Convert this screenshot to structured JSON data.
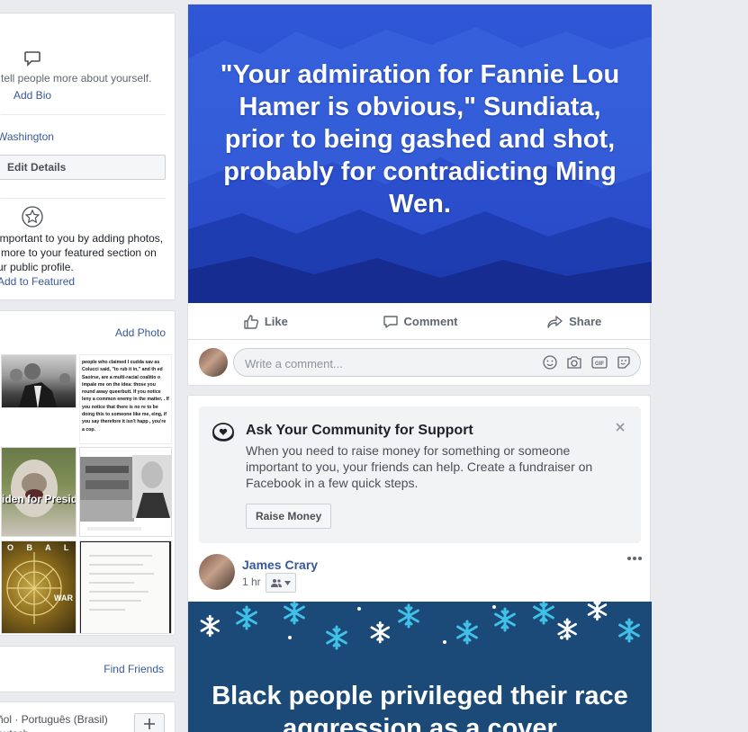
{
  "intro": {
    "bio_prompt": "tell people more about yourself.",
    "add_bio": "Add Bio",
    "location": "Washington",
    "edit_details": "Edit Details",
    "featured_line1": "important to you by adding photos,",
    "featured_line2": "more to your featured section on",
    "featured_line3": "ur public profile.",
    "add_featured": "Add to Featured"
  },
  "photos": {
    "add_photo": "Add Photo",
    "meme_text": "people who claimed I cudda sav as Colucci said, \"to rub it in,\" and th ed Saoirse, are a multi-racial coalitio o impale me on the idea: those you round away queerbutt. If you notice leny a common enemy in the matter, . If you notice that there is no re to be doing this to someone like me, eing, if you say therefore it isn't happ , you're a cop.",
    "caption_biden": "iden for Preside",
    "caption_war": "O B A L",
    "caption_war2": "WAR"
  },
  "friends": {
    "find_friends": "Find Friends"
  },
  "languages": {
    "text": "ñol · Português (Brasil)",
    "text2": "eutsch"
  },
  "post1": {
    "quote": "\"Your admiration for Fannie Lou Hamer is obvious,\" Sundiata, prior to being gashed and shot, probably for contradicting Ming Wen.",
    "like": "Like",
    "comment": "Comment",
    "share": "Share",
    "comment_placeholder": "Write a comment..."
  },
  "post2": {
    "fundraiser_title": "Ask Your Community for Support",
    "fundraiser_body": "When you need to raise money for something or someone important to you, your friends can help. Create a fundraiser on Facebook in a few quick steps.",
    "raise_money": "Raise Money",
    "author": "James Crary",
    "time": "1 hr",
    "snow_text": "Black people privileged their race aggression as a cover"
  },
  "colors": {
    "link": "#385898",
    "quote_bg": "#2b4fd0",
    "snow_bg": "#1b4a78",
    "page_bg": "#e9ebee"
  }
}
